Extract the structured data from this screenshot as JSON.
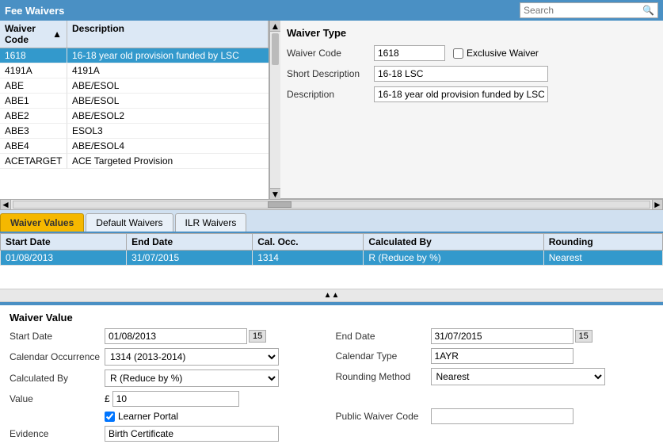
{
  "header": {
    "title": "Fee Waivers",
    "search_placeholder": "Search"
  },
  "waiver_list": {
    "col_code": "Waiver Code",
    "col_desc": "Description",
    "rows": [
      {
        "code": "1618",
        "description": "16-18 year old provision funded by LSC",
        "selected": true
      },
      {
        "code": "4191A",
        "description": "4191A"
      },
      {
        "code": "ABE",
        "description": "ABE/ESOL"
      },
      {
        "code": "ABE1",
        "description": "ABE/ESOL"
      },
      {
        "code": "ABE2",
        "description": "ABE/ESOL2"
      },
      {
        "code": "ABE3",
        "description": "ESOL3"
      },
      {
        "code": "ABE4",
        "description": "ABE/ESOL4"
      },
      {
        "code": "ACETARGET",
        "description": "ACE Targeted Provision"
      }
    ]
  },
  "waiver_type": {
    "title": "Waiver Type",
    "waiver_code_label": "Waiver Code",
    "waiver_code_value": "1618",
    "exclusive_waiver_label": "Exclusive Waiver",
    "short_desc_label": "Short Description",
    "short_desc_value": "16-18 LSC",
    "description_label": "Description",
    "description_value": "16-18 year old provision funded by LSC"
  },
  "tabs": [
    {
      "id": "waiver-values",
      "label": "Waiver Values",
      "active": true
    },
    {
      "id": "default-waivers",
      "label": "Default Waivers",
      "active": false
    },
    {
      "id": "ilr-waivers",
      "label": "ILR Waivers",
      "active": false
    }
  ],
  "values_table": {
    "columns": [
      "Start Date",
      "End Date",
      "Cal. Occ.",
      "Calculated By",
      "Rounding"
    ],
    "rows": [
      {
        "start_date": "01/08/2013",
        "end_date": "31/07/2015",
        "cal_occ": "1314",
        "calculated_by": "R (Reduce by %)",
        "rounding": "Nearest",
        "selected": true
      }
    ]
  },
  "waiver_value": {
    "title": "Waiver Value",
    "start_date_label": "Start Date",
    "start_date_value": "01/08/2013",
    "end_date_label": "End Date",
    "end_date_value": "31/07/2015",
    "cal_occ_label": "Calendar Occurrence",
    "cal_occ_value": "1314 (2013-2014)",
    "cal_occ_options": [
      "1314 (2013-2014)"
    ],
    "cal_type_label": "Calendar Type",
    "cal_type_value": "1AYR",
    "calculated_by_label": "Calculated By",
    "calculated_by_value": "R (Reduce by %)",
    "calculated_by_options": [
      "R (Reduce by %)"
    ],
    "rounding_label": "Rounding Method",
    "rounding_value": "Nearest",
    "rounding_options": [
      "Nearest"
    ],
    "value_label": "Value",
    "currency_symbol": "£",
    "value_amount": "10",
    "learner_portal_label": "Learner Portal",
    "learner_portal_checked": true,
    "public_waiver_label": "Public Waiver Code",
    "public_waiver_value": "",
    "evidence_label": "Evidence",
    "evidence_value": "Birth Certificate",
    "date_btn": "15"
  }
}
